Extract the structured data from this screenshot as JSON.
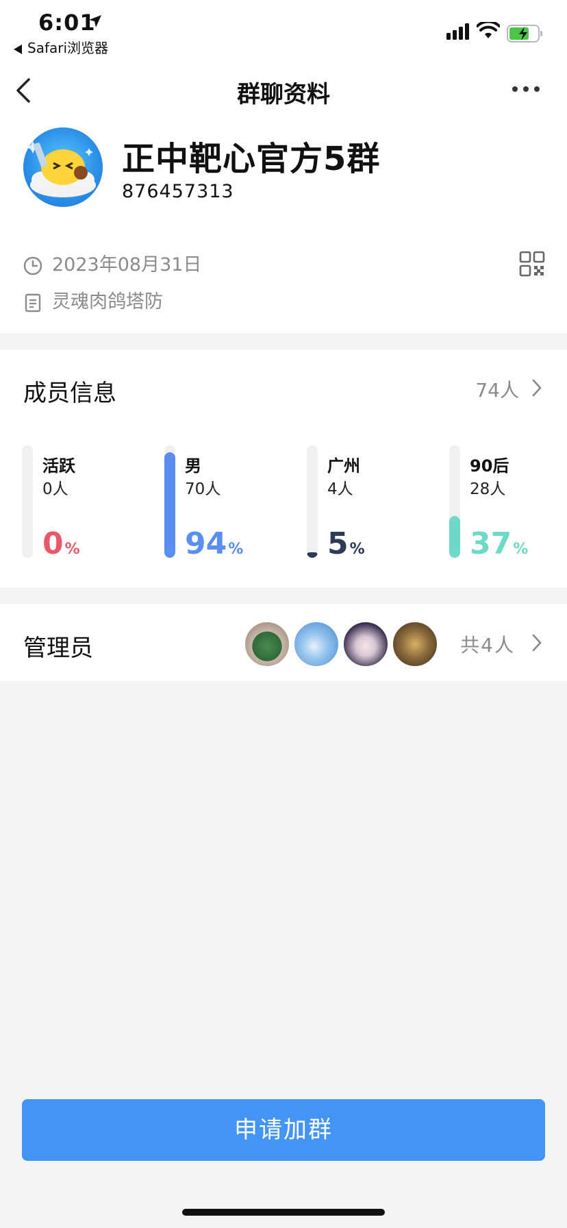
{
  "status_bar": {
    "time": "6:01",
    "back_app": "Safari浏览器"
  },
  "nav": {
    "title": "群聊资料"
  },
  "group": {
    "name": "正中靶心官方5群",
    "id": "876457313",
    "date": "2023年08月31日",
    "description": "灵魂肉鸽塔防"
  },
  "members": {
    "title": "成员信息",
    "count": "74人",
    "stats": [
      {
        "label": "活跃",
        "count": "0人",
        "percent": "0",
        "unit": "%",
        "color": "#e8596b",
        "fill": 0.0
      },
      {
        "label": "男",
        "count": "70人",
        "percent": "94",
        "unit": "%",
        "color": "#5a8ef0",
        "fill": 0.94
      },
      {
        "label": "广州",
        "count": "4人",
        "percent": "5",
        "unit": "%",
        "color": "#2e3a58",
        "fill": 0.05
      },
      {
        "label": "90后",
        "count": "28人",
        "percent": "37",
        "unit": "%",
        "color": "#6fd9c8",
        "fill": 0.37
      }
    ]
  },
  "admins": {
    "title": "管理员",
    "count": "共4人"
  },
  "join_button": "申请加群",
  "colors": {
    "accent": "#4394f5",
    "muted": "#8a8a8a",
    "background": "#f4f4f4"
  },
  "icons": [
    "location-arrow-icon",
    "back-chevron-icon",
    "more-icon",
    "clock-icon",
    "document-icon",
    "qr-code-icon",
    "chevron-right-icon",
    "signal-icon",
    "wifi-icon",
    "battery-icon"
  ]
}
